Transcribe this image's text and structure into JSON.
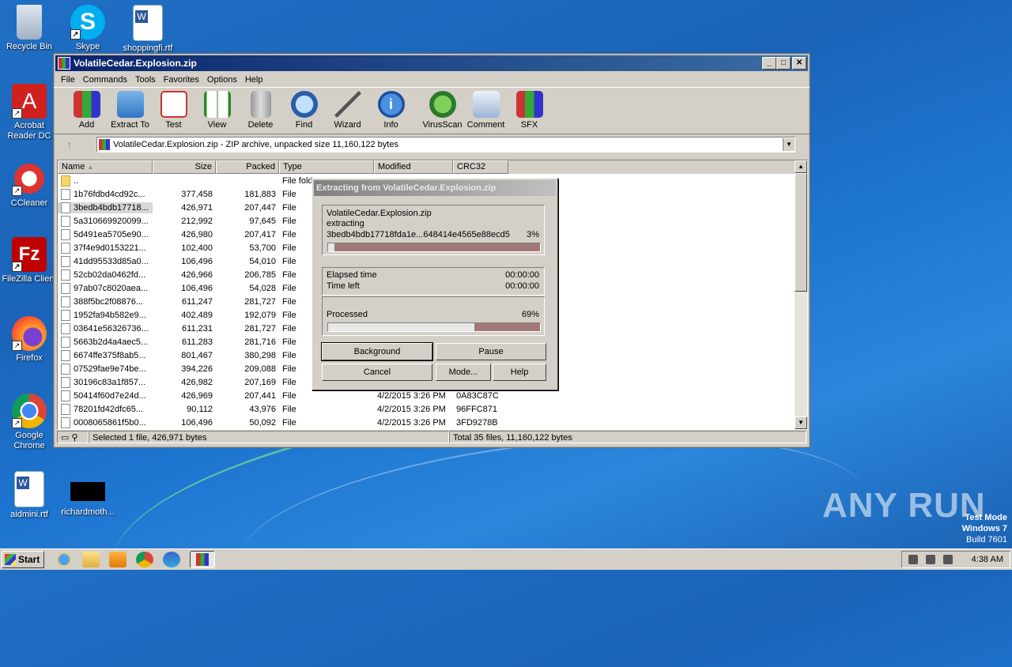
{
  "desktop": {
    "icons": [
      {
        "label": "Recycle Bin"
      },
      {
        "label": "Skype"
      },
      {
        "label": "shoppingfi.rtf"
      },
      {
        "label": "Acrobat Reader DC"
      },
      {
        "label": "CCleaner"
      },
      {
        "label": "FileZilla Client"
      },
      {
        "label": "Firefox"
      },
      {
        "label": "Google Chrome"
      },
      {
        "label": "aidmini.rtf"
      },
      {
        "label": "richardmoth..."
      }
    ],
    "watermark": "ANY RUN",
    "testmode": {
      "line1": "Test Mode",
      "line2": "Windows 7",
      "line3": "Build 7601"
    }
  },
  "window": {
    "title": "VolatileCedar.Explosion.zip",
    "menu": [
      "File",
      "Commands",
      "Tools",
      "Favorites",
      "Options",
      "Help"
    ],
    "toolbar": [
      "Add",
      "Extract To",
      "Test",
      "View",
      "Delete",
      "Find",
      "Wizard",
      "Info",
      "VirusScan",
      "Comment",
      "SFX"
    ],
    "address": "VolatileCedar.Explosion.zip - ZIP archive, unpacked size 11,160,122 bytes",
    "columns": [
      "Name",
      "Size",
      "Packed",
      "Type",
      "Modified",
      "CRC32"
    ],
    "rows": [
      {
        "name": "..",
        "size": "",
        "packed": "",
        "type": "File fold",
        "modified": "",
        "crc": "",
        "folder": true
      },
      {
        "name": "1b76fdbd4cd92c...",
        "size": "377,458",
        "packed": "181,883",
        "type": "File",
        "modified": "",
        "crc": ""
      },
      {
        "name": "3bedb4bdb17718...",
        "size": "426,971",
        "packed": "207,447",
        "type": "File",
        "modified": "",
        "crc": "",
        "selected": true
      },
      {
        "name": "5a310669920099...",
        "size": "212,992",
        "packed": "97,645",
        "type": "File",
        "modified": "",
        "crc": ""
      },
      {
        "name": "5d491ea5705e90...",
        "size": "426,980",
        "packed": "207,417",
        "type": "File",
        "modified": "",
        "crc": ""
      },
      {
        "name": "37f4e9d0153221...",
        "size": "102,400",
        "packed": "53,700",
        "type": "File",
        "modified": "",
        "crc": ""
      },
      {
        "name": "41dd95533d85a0...",
        "size": "106,496",
        "packed": "54,010",
        "type": "File",
        "modified": "",
        "crc": ""
      },
      {
        "name": "52cb02da0462fd...",
        "size": "426,966",
        "packed": "206,785",
        "type": "File",
        "modified": "",
        "crc": ""
      },
      {
        "name": "97ab07c8020aea...",
        "size": "106,496",
        "packed": "54,028",
        "type": "File",
        "modified": "",
        "crc": ""
      },
      {
        "name": "388f5bc2f08876...",
        "size": "611,247",
        "packed": "281,727",
        "type": "File",
        "modified": "",
        "crc": ""
      },
      {
        "name": "1952fa94b582e9...",
        "size": "402,489",
        "packed": "192,079",
        "type": "File",
        "modified": "",
        "crc": ""
      },
      {
        "name": "03641e56326736...",
        "size": "611,231",
        "packed": "281,727",
        "type": "File",
        "modified": "",
        "crc": ""
      },
      {
        "name": "5663b2d4a4aec5...",
        "size": "611,283",
        "packed": "281,716",
        "type": "File",
        "modified": "",
        "crc": ""
      },
      {
        "name": "6674ffe375f8ab5...",
        "size": "801,467",
        "packed": "380,298",
        "type": "File",
        "modified": "",
        "crc": ""
      },
      {
        "name": "07529fae9e74be...",
        "size": "394,226",
        "packed": "209,088",
        "type": "File",
        "modified": "",
        "crc": ""
      },
      {
        "name": "30196c83a1f857...",
        "size": "426,982",
        "packed": "207,169",
        "type": "File",
        "modified": "",
        "crc": ""
      },
      {
        "name": "50414f60d7e24d...",
        "size": "426,969",
        "packed": "207,441",
        "type": "File",
        "modified": "4/2/2015 3:26 PM",
        "crc": "0A83C87C"
      },
      {
        "name": "78201fd42dfc65...",
        "size": "90,112",
        "packed": "43,976",
        "type": "File",
        "modified": "4/2/2015 3:26 PM",
        "crc": "96FFC871"
      },
      {
        "name": "0008065861f5b0...",
        "size": "106,496",
        "packed": "50,092",
        "type": "File",
        "modified": "4/2/2015 3:26 PM",
        "crc": "3FD9278B"
      }
    ],
    "status_left": "Selected 1 file, 426,971 bytes",
    "status_right": "Total 35 files, 11,160,122 bytes"
  },
  "dialog": {
    "title": "Extracting from VolatileCedar.Explosion.zip",
    "archive": "VolatileCedar.Explosion.zip",
    "action": "extracting",
    "file": "3bedb4bdb17718fda1e...648414e4565e88ecd5",
    "file_percent": "3%",
    "file_progress": 0.03,
    "elapsed_label": "Elapsed time",
    "elapsed_value": "00:00:00",
    "left_label": "Time left",
    "left_value": "00:00:00",
    "processed_label": "Processed",
    "processed_percent": "69%",
    "processed_progress": 0.69,
    "buttons": {
      "background": "Background",
      "pause": "Pause",
      "cancel": "Cancel",
      "mode": "Mode...",
      "help": "Help"
    }
  },
  "taskbar": {
    "start": "Start",
    "clock": "4:38 AM"
  }
}
